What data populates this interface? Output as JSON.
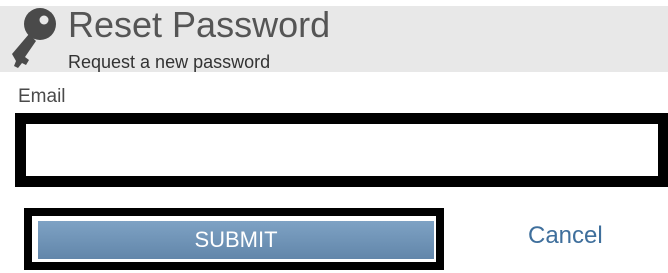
{
  "header": {
    "title": "Reset Password",
    "subtitle": "Request a new password",
    "icon": "key-icon"
  },
  "form": {
    "email_label": "Email",
    "email_value": "",
    "email_placeholder": "",
    "submit_label": "SUBMIT",
    "cancel_label": "Cancel"
  },
  "colors": {
    "header_bg": "#e8e8e8",
    "button_top": "#7ea2c4",
    "button_bottom": "#6286aa",
    "link": "#3f6f9c"
  }
}
